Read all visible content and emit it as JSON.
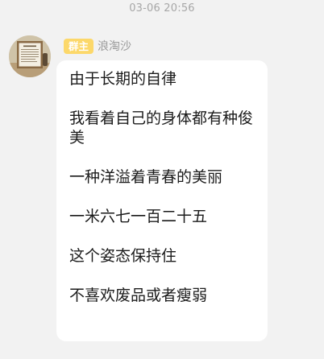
{
  "chat": {
    "timestamp": "03-06  20:56",
    "message": {
      "sender": {
        "role_badge": "群主",
        "name": "浪淘沙",
        "avatar_icon": "framed-certificate-avatar"
      },
      "lines": [
        "由于长期的自律",
        "我看着自己的身体都有种俊美",
        "一种洋溢着青春的美丽",
        "一米六七一百二十五",
        "这个姿态保持住",
        "不喜欢废品或者瘦弱"
      ]
    }
  },
  "colors": {
    "background": "#f2f2f2",
    "bubble": "#ffffff",
    "badge": "#fcd86a",
    "timestamp_text": "#a7a7a7",
    "sender_name_text": "#9a9a9a",
    "message_text": "#1b1b1b"
  }
}
